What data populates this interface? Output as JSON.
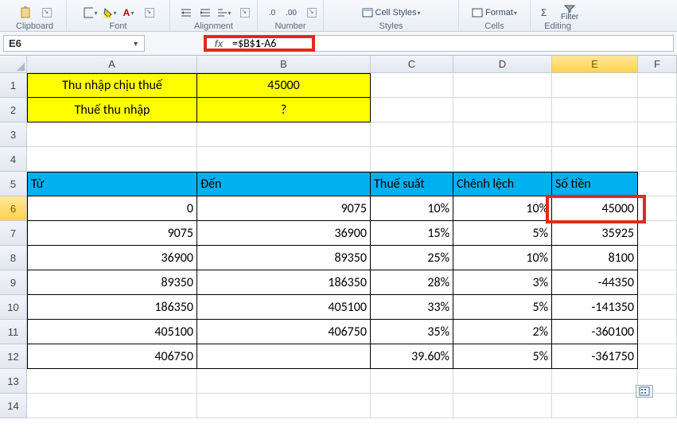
{
  "ribbon": {
    "groups": {
      "clipboard": "Clipboard",
      "font": "Font",
      "alignment": "Alignment",
      "number": "Number",
      "styles": "Styles",
      "cells": "Cells",
      "editing": "Editing"
    },
    "cellstyles": "Cell Styles",
    "format": "Format",
    "filter": "Filter"
  },
  "formula_bar": {
    "namebox": "E6",
    "formula_prefix": "=$B$",
    "formula_bold": "1",
    "formula_suffix": "-A6"
  },
  "columns": [
    "A",
    "B",
    "C",
    "D",
    "E",
    "F"
  ],
  "yellow_rows": [
    {
      "r": "1",
      "a": "Thu nhập chịu thuế",
      "b": "45000"
    },
    {
      "r": "2",
      "a": "Thuế thu nhập",
      "b": "?"
    }
  ],
  "header_row": {
    "r": "5",
    "tu": "Từ",
    "den": "Đến",
    "thuesuat": "Thuế suất",
    "chenhlech": "Chênh lệch",
    "sotien": "Số tiền"
  },
  "table_rows": [
    {
      "r": "6",
      "a": "0",
      "b": "9075",
      "c": "10%",
      "d": "10%",
      "e": "45000"
    },
    {
      "r": "7",
      "a": "9075",
      "b": "36900",
      "c": "15%",
      "d": "5%",
      "e": "35925"
    },
    {
      "r": "8",
      "a": "36900",
      "b": "89350",
      "c": "25%",
      "d": "10%",
      "e": "8100"
    },
    {
      "r": "9",
      "a": "89350",
      "b": "186350",
      "c": "28%",
      "d": "3%",
      "e": "-44350"
    },
    {
      "r": "10",
      "a": "186350",
      "b": "405100",
      "c": "33%",
      "d": "5%",
      "e": "-141350"
    },
    {
      "r": "11",
      "a": "405100",
      "b": "406750",
      "c": "35%",
      "d": "2%",
      "e": "-360100"
    },
    {
      "r": "12",
      "a": "406750",
      "b": "",
      "c": "39.60%",
      "d": "5%",
      "e": "-361750"
    }
  ],
  "empty_rows": [
    "3",
    "4"
  ],
  "tail_rows": [
    "13",
    "14"
  ],
  "chart_data": {
    "type": "table",
    "title": "Tax bracket table",
    "columns": [
      "Từ",
      "Đến",
      "Thuế suất",
      "Chênh lệch",
      "Số tiền"
    ],
    "rows": [
      [
        0,
        9075,
        "10%",
        "10%",
        45000
      ],
      [
        9075,
        36900,
        "15%",
        "5%",
        35925
      ],
      [
        36900,
        89350,
        "25%",
        "10%",
        8100
      ],
      [
        89350,
        186350,
        "28%",
        "3%",
        -44350
      ],
      [
        186350,
        405100,
        "33%",
        "5%",
        -141350
      ],
      [
        405100,
        406750,
        "35%",
        "2%",
        -360100
      ],
      [
        406750,
        null,
        "39.60%",
        "5%",
        -361750
      ]
    ],
    "inputs": {
      "Thu nhập chịu thuế": 45000,
      "Thuế thu nhập": "?"
    }
  }
}
